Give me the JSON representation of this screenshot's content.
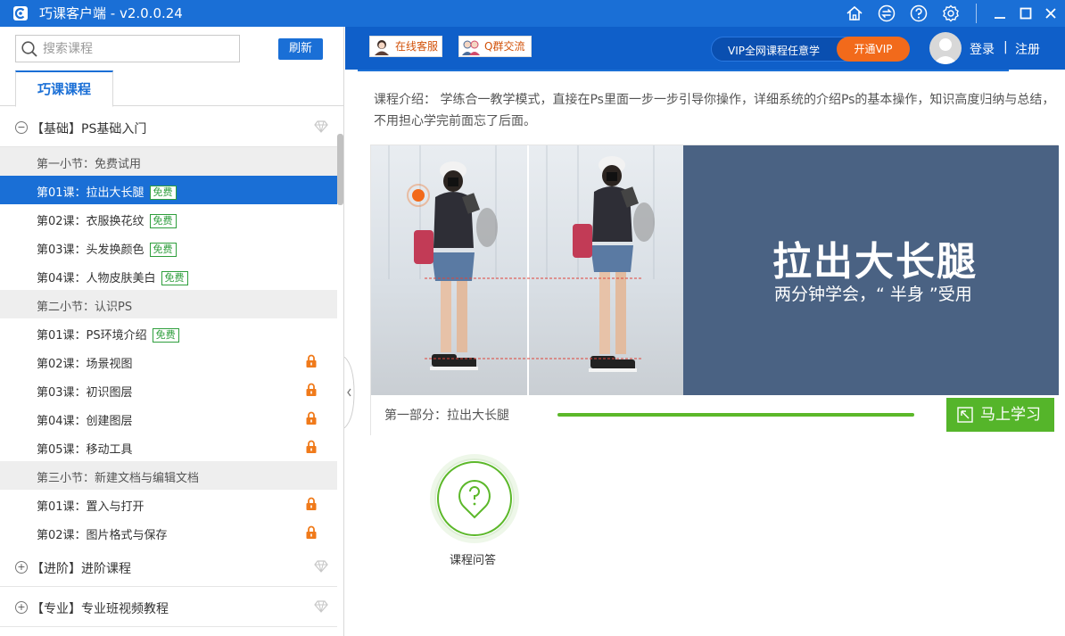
{
  "window": {
    "title": "巧课客户端 - v2.0.0.24",
    "titlebar_icons": [
      "home-icon",
      "sync-icon",
      "help-icon",
      "settings-icon"
    ],
    "controls": [
      "minimize",
      "maximize",
      "close"
    ]
  },
  "sidebar": {
    "search_placeholder": "搜索课程",
    "refresh_label": "刷新",
    "tab_label": "巧课课程",
    "groups": [
      {
        "title": "【基础】PS基础入门",
        "toggle": "−",
        "sections": [
          {
            "title": "第一小节：免费试用",
            "lessons": [
              {
                "title": "第01课：拉出大长腿",
                "free": "免费",
                "active": true
              },
              {
                "title": "第02课：衣服换花纹",
                "free": "免费"
              },
              {
                "title": "第03课：头发换颜色",
                "free": "免费"
              },
              {
                "title": "第04课：人物皮肤美白",
                "free": "免费"
              }
            ]
          },
          {
            "title": "第二小节：认识PS",
            "lessons": [
              {
                "title": "第01课：PS环境介绍",
                "free": "免费"
              },
              {
                "title": "第02课：场景视图",
                "locked": true
              },
              {
                "title": "第03课：初识图层",
                "locked": true
              },
              {
                "title": "第04课：创建图层",
                "locked": true
              },
              {
                "title": "第05课：移动工具",
                "locked": true
              }
            ]
          },
          {
            "title": "第三小节：新建文档与编辑文档",
            "lessons": [
              {
                "title": "第01课：置入与打开",
                "locked": true
              },
              {
                "title": "第02课：图片格式与保存",
                "locked": true
              }
            ]
          }
        ]
      },
      {
        "title": "【进阶】进阶课程",
        "toggle": "+"
      },
      {
        "title": "【专业】专业班视频教程",
        "toggle": "+"
      }
    ]
  },
  "topbar": {
    "service_label": "在线客服",
    "qq_label": "Q群交流",
    "vip_text": "VIP全网课程任意学",
    "vip_button": "开通VIP",
    "login": "登录",
    "separator": "|",
    "register": "注册"
  },
  "course": {
    "intro": "课程介绍： 学练合一教学模式，直接在Ps里面一步一步引导你操作，详细系统的介绍Ps的基本操作，知识高度归纳与总结，不用担心学完前面忘了后面。",
    "banner_title": "拉出大长腿",
    "banner_subtitle": "两分钟学会，“ 半身 ”受用",
    "part_label": "第一部分：拉出大长腿",
    "progress": 1.0,
    "study_button": "马上学习",
    "qa_label": "课程问答"
  },
  "colors": {
    "primary": "#1a6fd6",
    "topbar": "#0f5fc9",
    "vip_orange": "#f26a1b",
    "free_green": "#2e9e3c",
    "study_green": "#55b52a",
    "lock_orange": "#f07a1a",
    "banner_blue": "#4a6283"
  }
}
